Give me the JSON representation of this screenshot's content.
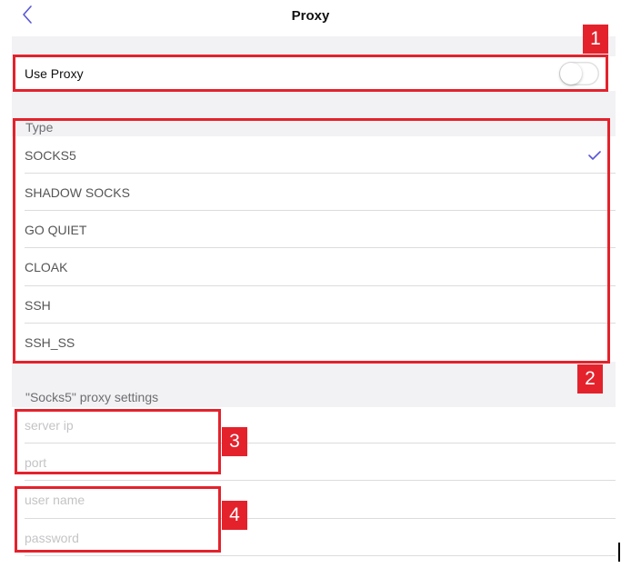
{
  "nav": {
    "title": "Proxy",
    "back_icon": "chevron-left-icon",
    "accent": "#5856d6"
  },
  "use_proxy": {
    "label": "Use Proxy",
    "enabled": false
  },
  "type_section": {
    "header": "Type",
    "options": [
      {
        "label": "SOCKS5",
        "selected": true
      },
      {
        "label": "SHADOW SOCKS",
        "selected": false
      },
      {
        "label": "GO QUIET",
        "selected": false
      },
      {
        "label": "CLOAK",
        "selected": false
      },
      {
        "label": "SSH",
        "selected": false
      },
      {
        "label": "SSH_SS",
        "selected": false
      }
    ]
  },
  "settings": {
    "header": "\"Socks5\" proxy settings",
    "server_ip_placeholder": "server ip",
    "port_placeholder": "port",
    "username_placeholder": "user name",
    "password_placeholder": "password"
  },
  "callouts": {
    "one": "1",
    "two": "2",
    "three": "3",
    "four": "4",
    "color": "#e4222c"
  }
}
